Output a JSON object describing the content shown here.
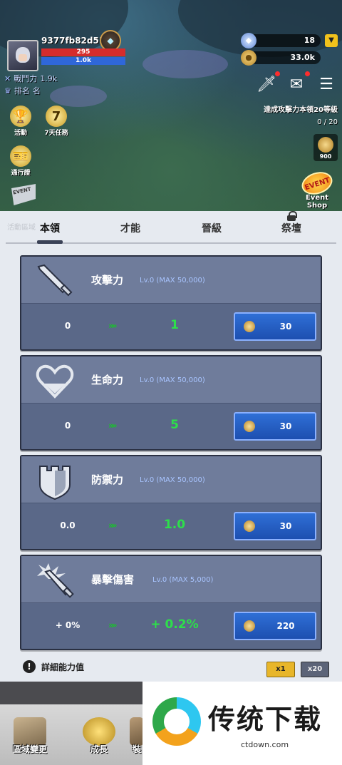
{
  "player": {
    "name": "9377fb82d516",
    "hp": "295",
    "mp": "1.0k",
    "combat_power_label": "戰鬥力",
    "combat_power": "1.9k",
    "rank_label": "排名",
    "rank_value": "名"
  },
  "currency": {
    "gems": "18",
    "gold": "33.0k"
  },
  "quest": {
    "text": "達成攻擊力本領20等級",
    "progress": "0 / 20",
    "reward": "900"
  },
  "side_buttons": {
    "activity": "活動",
    "seven_day": "7天任務",
    "pass": "通行證"
  },
  "event_shop": {
    "badge": "EVENT",
    "label": "Event Shop",
    "flag": "EVENT"
  },
  "tabs": {
    "faded": "活動區域",
    "skills": "本領",
    "talent": "才能",
    "promotion": "晉級",
    "altar": "祭壇"
  },
  "cards": [
    {
      "title": "攻擊力",
      "level": "Lv.0 (MAX 50,000)",
      "current": "0",
      "arrows": "»»",
      "next": "1",
      "cost": "30"
    },
    {
      "title": "生命力",
      "level": "Lv.0 (MAX 50,000)",
      "current": "0",
      "arrows": "»»",
      "next": "5",
      "cost": "30"
    },
    {
      "title": "防禦力",
      "level": "Lv.0 (MAX 50,000)",
      "current": "0.0",
      "arrows": "»»",
      "next": "1.0",
      "cost": "30"
    },
    {
      "title": "暴擊傷害",
      "level": "Lv.0 (MAX 5,000)",
      "current": "+ 0%",
      "arrows": "»»",
      "next": "+ 0.2%",
      "cost": "220"
    }
  ],
  "footer": {
    "details": "詳細能力值",
    "x1": "x1",
    "x20": "x20"
  },
  "bottom_nav": {
    "region": "區域變更",
    "growth": "成長",
    "third": "裝"
  },
  "watermark": {
    "title": "传统下载",
    "url": "ctdown.com"
  },
  "colors": {
    "card_bg": "#5a6888",
    "upgrade_button": "#2f6fd6",
    "next_value": "#2de04a"
  }
}
